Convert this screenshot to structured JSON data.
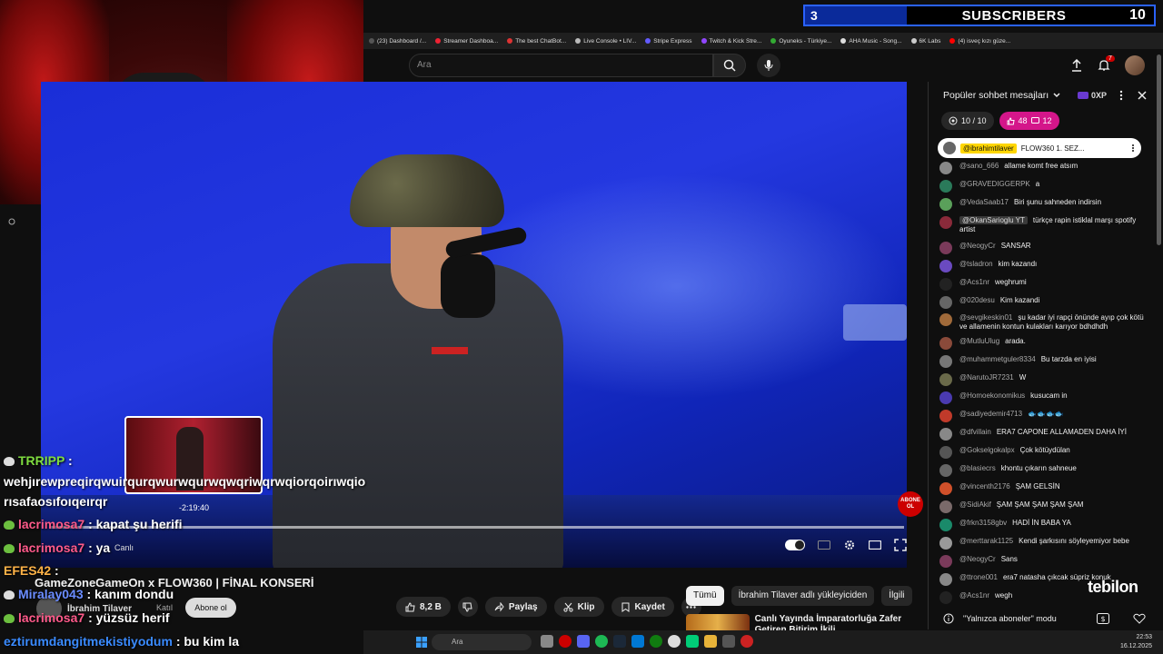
{
  "overlay": {
    "subscriber_bar": {
      "left_count": "3",
      "label": "SUBSCRIBERS",
      "right_count": "10"
    }
  },
  "browser": {
    "bookmarks": [
      "(23) Dashboard /...",
      "Streamer Dashboa...",
      "The best ChatBot...",
      "Live Console • LIV...",
      "Stripe Express",
      "Twitch & Kick Stre...",
      "Oyuneks - Türkiye...",
      "AHA Music - Song...",
      "6K Labs",
      "(4) isveç kızı güze..."
    ]
  },
  "youtube": {
    "search_placeholder": "Ara",
    "notifications_count": "7"
  },
  "player": {
    "preview_time": "-2:19:40",
    "live_label": "Canlı",
    "subscribe_badge": "ABONE OL"
  },
  "stream_chat": [
    {
      "user": "TRRIPP",
      "text": ":",
      "color": "#7fdc3f"
    },
    {
      "user": "",
      "text": "wehjırewpreqirqwuirqurqwurwqurwqwqriwqrwqiorqoirıwqio",
      "color": "#ffffff"
    },
    {
      "user": "",
      "text": "rısafaosıfoıqeırqr",
      "color": "#ffffff"
    },
    {
      "user": "lacrimosa7",
      "text": ": kapat şu herifi",
      "color": "#ff5a8a"
    },
    {
      "user": "lacrimosa7",
      "text": ": ya",
      "color": "#ff5a8a"
    },
    {
      "user": "EFES42",
      "text": ":",
      "color": "#ffb347"
    },
    {
      "user": "Miralay043",
      "text": ": kanım dondu",
      "color": "#6a8cff"
    },
    {
      "user": "lacrimosa7",
      "text": ": yüzsüz herif",
      "color": "#ff5a8a"
    },
    {
      "user": "eztirumdangitmekistiyodum",
      "text": ": bu kim la",
      "color": "#3a8bff"
    }
  ],
  "video": {
    "title": "GameZoneGameOn x FLOW360 | FİNAL KONSERİ",
    "channel": "İbrahim Tilaver",
    "join_label": "Katıl",
    "subscribe_label": "Abone ol",
    "likes": "8,2 B",
    "share_label": "Paylaş",
    "clip_label": "Klip",
    "save_label": "Kaydet"
  },
  "recommendations": {
    "chips": [
      "Tümü",
      "İbrahim Tilaver adlı yükleyiciden",
      "İlgili"
    ],
    "first_title": "Canlı Yayında İmparatorluğa Zafer Getiren Bitirim İkili"
  },
  "live_chat": {
    "header": "Popüler sohbet mesajları",
    "xp": "0XP",
    "progress": "10 / 10",
    "likes": "48",
    "comments": "12",
    "pinned": {
      "user": "@ibrahimtilaver",
      "text": "FLOW360 1. SEZ..."
    },
    "messages": [
      {
        "user": "@sano_666",
        "text": "allame komt free atsım",
        "color": "#888"
      },
      {
        "user": "@GRAVEDIGGERPK",
        "text": "a",
        "color": "#2a7a5a"
      },
      {
        "user": "@VedaSaab17",
        "text": "Biri şunu sahneden indirsin",
        "color": "#5aa05a"
      },
      {
        "user": "@OkanSarioglu YT",
        "text": "türkçe rapin istiklal marşı spotify artist",
        "color": "#8a2a3a",
        "hl": true
      },
      {
        "user": "@NeogyCr",
        "text": "SANSAR",
        "color": "#7a3a5a"
      },
      {
        "user": "@tsladron",
        "text": "kim kazandı",
        "color": "#6a4ac0"
      },
      {
        "user": "@Acs1nr",
        "text": "weghrumi",
        "color": "#222"
      },
      {
        "user": "@020desu",
        "text": "Kim kazandi",
        "color": "#666"
      },
      {
        "user": "@sevgikeskin01",
        "text": "şu kadar iyi rapçi önünde ayıp çok kötü ve allamenin kontun kulakları karıyor bdhdhdh",
        "color": "#a06a3a"
      },
      {
        "user": "@MutluUlug",
        "text": "arada.",
        "color": "#8a4a3a"
      },
      {
        "user": "@muhammetguler8334",
        "text": "Bu tarzda en iyisi",
        "color": "#777"
      },
      {
        "user": "@NarutoJR7231",
        "text": "W",
        "color": "#6a6a4a"
      },
      {
        "user": "@Homoekonomikus",
        "text": "kusucam in",
        "color": "#4a3ab0"
      },
      {
        "user": "@sadiyedemir4713",
        "text": "🐟🐟🐟🐟",
        "color": "#c03a2a"
      },
      {
        "user": "@dfvillain",
        "text": "ERA7 CAPONE ALLAMADEN DAHA İYİ",
        "color": "#888"
      },
      {
        "user": "@Gokselgokalpx",
        "text": "Çok kötüydülan",
        "color": "#555"
      },
      {
        "user": "@blasiecrs",
        "text": "khontu çıkarın sahneue",
        "color": "#666"
      },
      {
        "user": "@vincenth2176",
        "text": "ŞAM GELSİN",
        "color": "#d0502a"
      },
      {
        "user": "@SidiAkif",
        "text": "ŞAM ŞAM ŞAM ŞAM ŞAM",
        "color": "#7a6a6a"
      },
      {
        "user": "@frkn3158gbv",
        "text": "HADİ İN BABA YA",
        "color": "#1a8a6a"
      },
      {
        "user": "@merttarak1125",
        "text": "Kendi şarkısını söyleyemiyor bebe",
        "color": "#999"
      },
      {
        "user": "@NeogyCr",
        "text": "Sans",
        "color": "#7a3a5a"
      },
      {
        "user": "@ttrone001",
        "text": "era7 natasha çıkcak süpriz konuk",
        "color": "#888"
      },
      {
        "user": "@Acs1nr",
        "text": "wegh",
        "color": "#222"
      }
    ],
    "footer": "\"Yalnızca aboneler\" modu"
  },
  "watermark": "tebilon",
  "taskbar": {
    "search": "Ara",
    "time": "22:53",
    "date": "16.12.2025"
  }
}
